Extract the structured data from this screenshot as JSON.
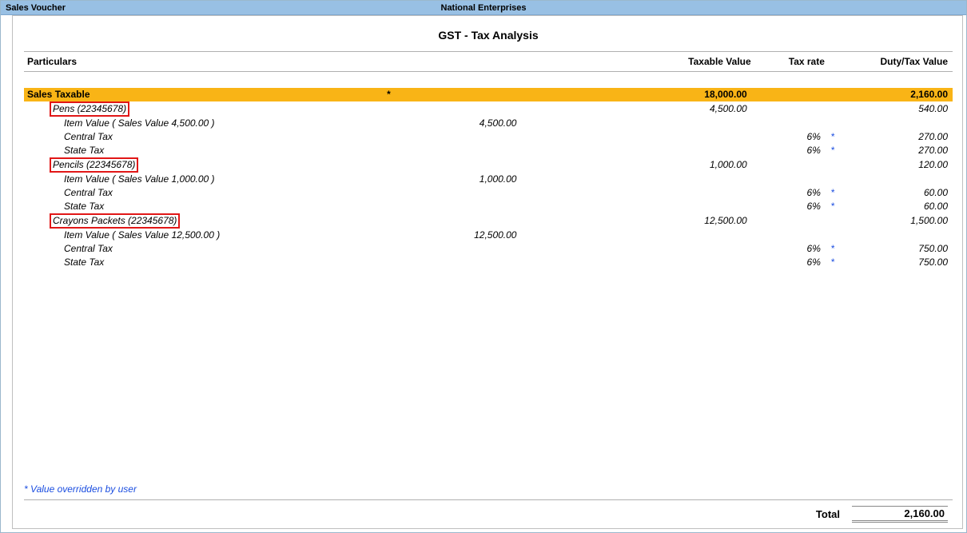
{
  "header": {
    "left": "Sales Voucher",
    "center": "National Enterprises"
  },
  "title": "GST - Tax Analysis",
  "columns": {
    "particulars": "Particulars",
    "taxable": "Taxable Value",
    "rate": "Tax rate",
    "duty": "Duty/Tax Value"
  },
  "summary": {
    "label": "Sales Taxable",
    "mark": "*",
    "taxable": "18,000.00",
    "duty": "2,160.00"
  },
  "items": [
    {
      "name": "Pens (22345678)",
      "taxable": "4,500.00",
      "duty": "540.00",
      "value_label": "Item Value ( Sales Value 4,500.00 )",
      "value_amt": "4,500.00",
      "taxes": [
        {
          "label": "Central Tax",
          "rate": "6%",
          "ast": "*",
          "duty": "270.00"
        },
        {
          "label": "State Tax",
          "rate": "6%",
          "ast": "*",
          "duty": "270.00"
        }
      ]
    },
    {
      "name": "Pencils (22345678)",
      "taxable": "1,000.00",
      "duty": "120.00",
      "value_label": "Item Value ( Sales Value 1,000.00 )",
      "value_amt": "1,000.00",
      "taxes": [
        {
          "label": "Central Tax",
          "rate": "6%",
          "ast": "*",
          "duty": "60.00"
        },
        {
          "label": "State Tax",
          "rate": "6%",
          "ast": "*",
          "duty": "60.00"
        }
      ]
    },
    {
      "name": "Crayons Packets (22345678)",
      "taxable": "12,500.00",
      "duty": "1,500.00",
      "value_label": "Item Value ( Sales Value 12,500.00 )",
      "value_amt": "12,500.00",
      "taxes": [
        {
          "label": "Central Tax",
          "rate": "6%",
          "ast": "*",
          "duty": "750.00"
        },
        {
          "label": "State Tax",
          "rate": "6%",
          "ast": "*",
          "duty": "750.00"
        }
      ]
    }
  ],
  "footnote": "* Value overridden by user",
  "total": {
    "label": "Total",
    "value": "2,160.00"
  }
}
